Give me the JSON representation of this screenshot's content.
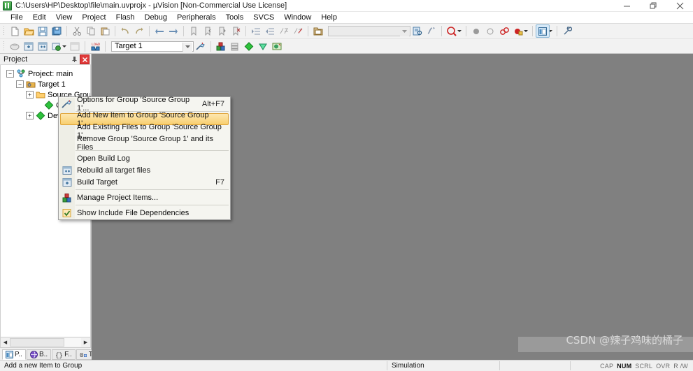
{
  "window": {
    "title": "C:\\Users\\HP\\Desktop\\file\\main.uvprojx - µVision  [Non-Commercial Use License]",
    "icon": "uvision-icon",
    "controls": {
      "minimize": "minimize-icon",
      "restore": "restore-icon",
      "close": "close-icon"
    }
  },
  "menubar": {
    "items": [
      {
        "label": "File"
      },
      {
        "label": "Edit"
      },
      {
        "label": "View"
      },
      {
        "label": "Project"
      },
      {
        "label": "Flash"
      },
      {
        "label": "Debug"
      },
      {
        "label": "Peripherals"
      },
      {
        "label": "Tools"
      },
      {
        "label": "SVCS"
      },
      {
        "label": "Window"
      },
      {
        "label": "Help"
      }
    ]
  },
  "toolbar_main": {
    "groups": [
      [
        "new-file-icon",
        "open-file-icon",
        "save-file-icon",
        "save-all-icon"
      ],
      [
        "cut-icon",
        "copy-icon",
        "paste-icon"
      ],
      [
        "undo-icon",
        "redo-icon"
      ],
      [
        "navigate-back-icon",
        "navigate-forward-icon"
      ],
      [
        "bookmark-toggle-icon",
        "bookmark-prev-icon",
        "bookmark-next-icon",
        "bookmark-clear-icon"
      ],
      [
        "indent-icon",
        "outdent-icon",
        "comment-icon",
        "uncomment-icon"
      ]
    ]
  },
  "toolbar_build": {
    "left_icons": [
      "translate-icon",
      "build-icon",
      "rebuild-all-icon",
      "batch-build-icon",
      "stop-build-icon",
      "download-icon"
    ],
    "target_select": {
      "value": "Target 1",
      "label": "target-select"
    },
    "right_icons": [
      "options-target-icon",
      "manage-project-items-icon",
      "manage-run-time-env-icon",
      "start-debug-icon",
      "insert-bookmark-icon",
      "configure-flash-icon"
    ]
  },
  "toolbar_right": {
    "open-icon": "open-document-icon",
    "find_box": {
      "value": "",
      "placeholder": ""
    },
    "icons": [
      "find-in-files-icon",
      "function-browser-icon",
      "magnifier-icon",
      "breakpoint-icon",
      "breakpoint-disable-icon",
      "breakpoint-kill-all-icon",
      "breakpoint-enable-icon",
      "window-layout-icon",
      "configure-icon"
    ]
  },
  "project_panel": {
    "title": "Project",
    "pin": "pin-icon",
    "close": "close-icon",
    "tree": [
      {
        "label": "Project: main",
        "icon": "project-icon",
        "expander": "-",
        "indent": 0
      },
      {
        "label": "Target 1",
        "icon": "target-icon",
        "expander": "-",
        "indent": 1
      },
      {
        "label": "Source Group",
        "icon": "folder-icon",
        "expander": "+",
        "indent": 2
      },
      {
        "label": "CM",
        "icon": "component-icon",
        "expander": "",
        "indent": 3
      },
      {
        "label": "Dev",
        "icon": "component-icon",
        "expander": "+",
        "indent": 2
      }
    ],
    "tabs": [
      {
        "label": "P..",
        "icon": "project-tab-icon",
        "active": true
      },
      {
        "label": "B..",
        "icon": "books-tab-icon",
        "active": false
      },
      {
        "label": "F..",
        "icon": "functions-tab-icon",
        "active": false
      },
      {
        "label": "T..",
        "icon": "templates-tab-icon",
        "active": false
      }
    ],
    "hscroll": {
      "left": "scroll-left-icon",
      "right": "scroll-right-icon"
    }
  },
  "context_menu": {
    "items": [
      {
        "label": "Options for Group 'Source Group 1'...",
        "accel": "Alt+F7",
        "icon": "options-icon",
        "highlighted": false,
        "separator_after": true
      },
      {
        "label": "Add New  Item to Group 'Source Group 1'...",
        "accel": "",
        "icon": "",
        "highlighted": true,
        "separator_after": false
      },
      {
        "label": "Add Existing Files to Group 'Source Group 1'...",
        "accel": "",
        "icon": "",
        "highlighted": false,
        "separator_after": false
      },
      {
        "label": "Remove Group 'Source Group 1' and its Files",
        "accel": "",
        "icon": "",
        "highlighted": false,
        "separator_after": true
      },
      {
        "label": "Open Build Log",
        "accel": "",
        "icon": "",
        "highlighted": false,
        "separator_after": false
      },
      {
        "label": "Rebuild all target files",
        "accel": "",
        "icon": "rebuild-icon",
        "highlighted": false,
        "separator_after": false
      },
      {
        "label": "Build Target",
        "accel": "F7",
        "icon": "build-icon",
        "highlighted": false,
        "separator_after": true
      },
      {
        "label": "Manage Project Items...",
        "accel": "",
        "icon": "manage-items-icon",
        "highlighted": false,
        "separator_after": true
      },
      {
        "label": "Show Include File Dependencies",
        "accel": "",
        "icon": "check-icon",
        "highlighted": false,
        "separator_after": false
      }
    ]
  },
  "statusbar": {
    "message": "Add a new Item to Group",
    "mode": "Simulation",
    "indicators": [
      {
        "label": "CAP",
        "active": false
      },
      {
        "label": "NUM",
        "active": true
      },
      {
        "label": "SCRL",
        "active": false
      },
      {
        "label": "OVR",
        "active": false
      },
      {
        "label": "R /W",
        "active": false
      }
    ]
  },
  "watermark": {
    "text": "CSDN @辣子鸡味的橘子"
  },
  "colors": {
    "accent_highlight": "#f8cf70",
    "highlight_border": "#e0a53b",
    "editor_bg": "#808080",
    "chrome_bg": "#f0f0f0",
    "close_red": "#e03a3a"
  }
}
